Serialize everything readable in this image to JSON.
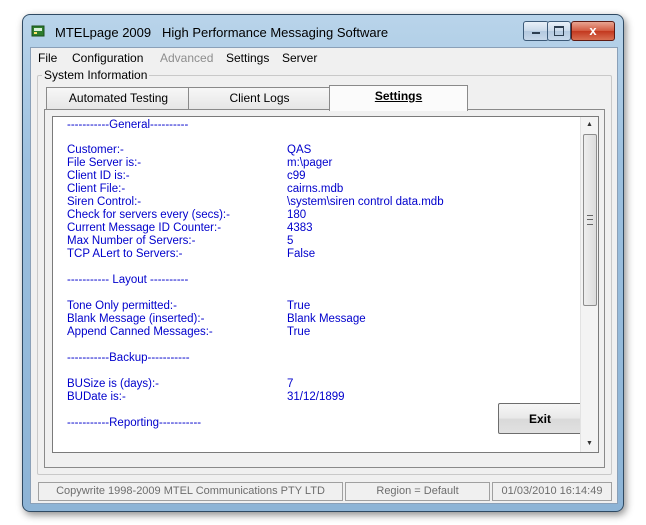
{
  "window": {
    "title_app": "MTELpage 2009",
    "title_desc": "High Performance Messaging Software",
    "close_glyph": "x"
  },
  "menu": [
    "File",
    "Configuration",
    "Advanced",
    "Settings",
    "Server"
  ],
  "menu_disabled": [
    "Advanced"
  ],
  "group_title": "System Information",
  "tabs": [
    "Automated Testing",
    "Client Logs",
    "Settings"
  ],
  "active_tab": "Settings",
  "settings": {
    "general_header": "-----------General----------",
    "customer_label": "Customer:-",
    "customer_value": "QAS",
    "file_server_label": "File Server is:-",
    "file_server_value": "m:\\pager",
    "client_id_label": "Client ID is:-",
    "client_id_value": "c99",
    "client_file_label": "Client File:-",
    "client_file_value": "cairns.mdb",
    "siren_label": "Siren Control:-",
    "siren_value": "\\system\\siren control data.mdb",
    "check_label": "Check for servers every (secs):-",
    "check_value": "180",
    "msg_counter_label": "Current Message ID Counter:-",
    "msg_counter_value": "4383",
    "max_servers_label": "Max Number of Servers:-",
    "max_servers_value": "5",
    "tcp_label": "TCP ALert to Servers:-",
    "tcp_value": "False",
    "layout_header": "----------- Layout ----------",
    "tone_label": "Tone Only permitted:-",
    "tone_value": "True",
    "blank_label": "Blank Message (inserted):-",
    "blank_value": "Blank Message",
    "append_label": "Append Canned Messages:-",
    "append_value": "True",
    "backup_header": "-----------Backup-----------",
    "busize_label": "BUSize is (days):-",
    "busize_value": "7",
    "budate_label": "BUDate is:-",
    "budate_value": "31/12/1899",
    "reporting_header": "-----------Reporting-----------"
  },
  "exit_label": "Exit",
  "status": {
    "copyright": "Copywrite 1998-2009 MTEL Communications PTY LTD",
    "region": "Region = Default",
    "datetime": "01/03/2010 16:14:49"
  },
  "colors": {
    "text_blue": "#0000cc",
    "close_red": "#c3381e",
    "title_blue": "#9cc0df"
  },
  "icons": [
    "app-icon",
    "minimize-icon",
    "maximize-icon",
    "close-icon",
    "scroll-up-icon",
    "scroll-down-icon"
  ]
}
